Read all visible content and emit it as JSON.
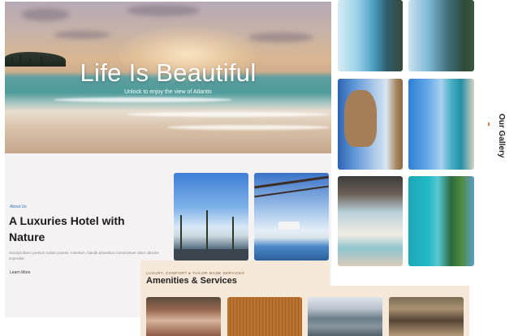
{
  "hero": {
    "title": "Life Is Beautiful",
    "subtitle": "Unlock to enjoy the view of Atlantis"
  },
  "about": {
    "tag": "About Us",
    "title": "A Luxuries Hotel with Nature",
    "description": "Suscipit libero pretium nullam potenti. Interdum, blandit phasellus consectetuer dolor ultricies imperdiet.",
    "more_label": "Learn More"
  },
  "gallery": {
    "label": "Our Gallery",
    "accent_color": "#e07a3a"
  },
  "amenities": {
    "tag": "LUXURY, COMFORT & TAILOR MADE SERVICES",
    "title": "Amenities & Services",
    "background": "#f6e8d9"
  }
}
